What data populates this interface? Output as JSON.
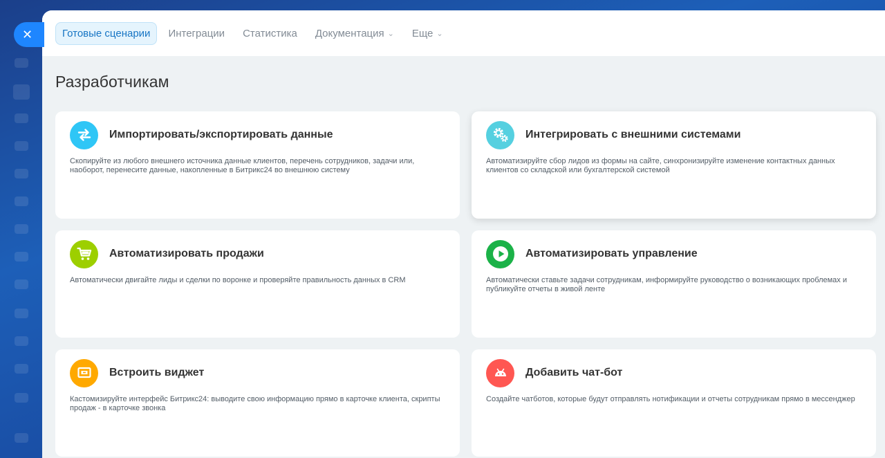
{
  "tabs": [
    {
      "label": "Готовые сценарии"
    },
    {
      "label": "Интеграции"
    },
    {
      "label": "Статистика"
    },
    {
      "label": "Документация"
    },
    {
      "label": "Еще"
    }
  ],
  "page": {
    "title": "Разработчикам"
  },
  "close": {
    "glyph": "✕"
  },
  "cards": [
    {
      "title": "Импортировать/экспортировать данные",
      "description": "Скопируйте из любого внешнего источника данные клиентов, перечень сотрудников, задачи или, наоборот, перенесите данные, накопленные в Битрикс24 во внешнюю систему",
      "icon": "arrows-exchange-icon",
      "color": "#2fc6f6"
    },
    {
      "title": "Интегрировать с внешними системами",
      "description": "Автоматизируйте сбор лидов из формы на сайте, синхронизируйте изменение контактных данных клиентов со складской или бухгалтерской системой",
      "icon": "gears-icon",
      "color": "#55d0e0"
    },
    {
      "title": "Автоматизировать продажи",
      "description": "Автоматически двигайте лиды и сделки по воронке и проверяйте правильность данных в CRM",
      "icon": "cart-icon",
      "color": "#9dcf00"
    },
    {
      "title": "Автоматизировать управление",
      "description": "Автоматически ставьте задачи сотрудникам, информируйте руководство о возникающих проблемах и публикуйте отчеты в живой ленте",
      "icon": "play-icon",
      "color": "#1bb248"
    },
    {
      "title": "Встроить виджет",
      "description": "Кастомизируйте интерфейс Битрикс24: выводите свою информацию прямо в карточке клиента, скрипты продаж - в карточке звонка",
      "icon": "widget-icon",
      "color": "#ffa900"
    },
    {
      "title": "Добавить чат-бот",
      "description": "Создайте чатботов, которые будут отправлять нотификации и отчеты сотрудникам прямо в мессенджер",
      "icon": "robot-icon",
      "color": "#ff5752"
    }
  ]
}
